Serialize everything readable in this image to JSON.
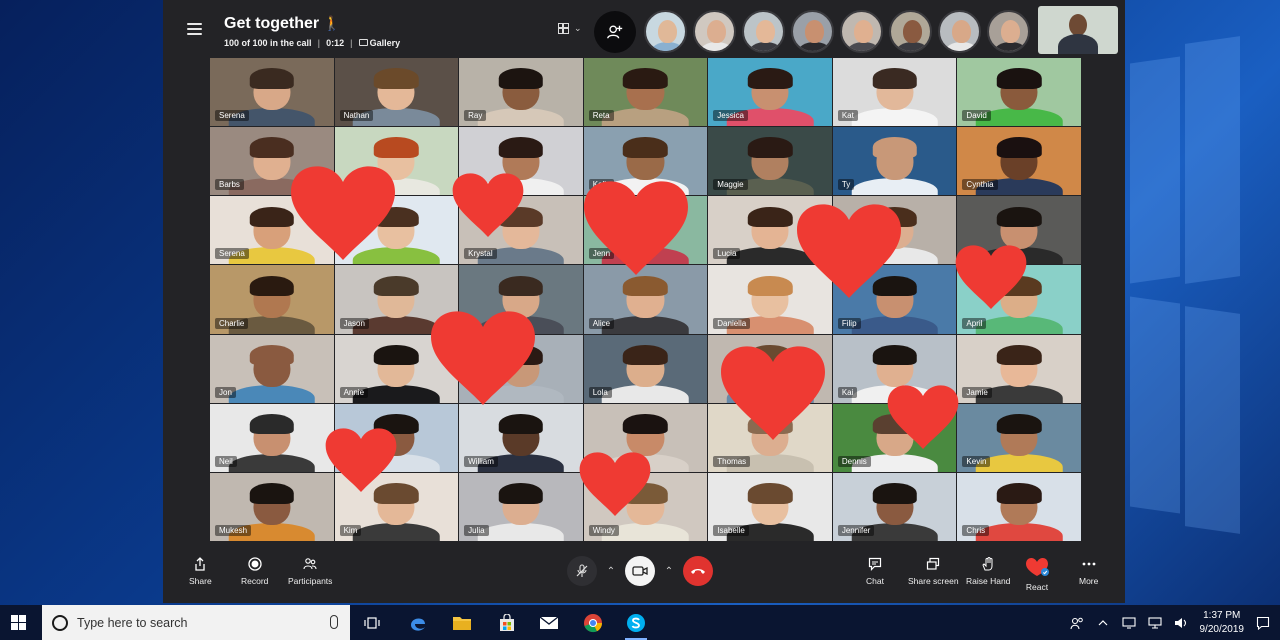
{
  "call": {
    "title": "Get together",
    "title_emoji": "🚶",
    "participants_text": "100 of 100 in the call",
    "duration": "0:12",
    "view_label": "Gallery"
  },
  "gallery": {
    "tiles": [
      {
        "name": "Serena",
        "bg": "#7a6a5a",
        "skin": "#d8a888",
        "hair": "#3a2a20",
        "shirt": "#44556a"
      },
      {
        "name": "Nathan",
        "bg": "#5b5048",
        "skin": "#e4b898",
        "hair": "#6b4a2a",
        "shirt": "#7a8a9a"
      },
      {
        "name": "Ray",
        "bg": "#b8b2a8",
        "skin": "#8a5c3e",
        "hair": "#1c1410",
        "shirt": "#d6c8b8"
      },
      {
        "name": "Reta",
        "bg": "#6f8a5a",
        "skin": "#a8704e",
        "hair": "#2a1a12",
        "shirt": "#b8a080"
      },
      {
        "name": "Jessica",
        "bg": "#4aa8c8",
        "skin": "#c89070",
        "hair": "#2a1a14",
        "shirt": "#e0506a"
      },
      {
        "name": "Kat",
        "bg": "#dcdcdc",
        "skin": "#e2b89a",
        "hair": "#3a2a22",
        "shirt": "#f4f4f4"
      },
      {
        "name": "David",
        "bg": "#a0c8a0",
        "skin": "#8a5a3c",
        "hair": "#1a1210",
        "shirt": "#48b848"
      },
      {
        "name": "Barbs",
        "bg": "#9a8a80",
        "skin": "#e0b090",
        "hair": "#4a2e20",
        "shirt": "#8a6a60"
      },
      {
        "name": "",
        "bg": "#c8d8c0",
        "skin": "#e8c0a0",
        "hair": "#b84a20",
        "shirt": "#e8e8e0"
      },
      {
        "name": "",
        "bg": "#d0d0d4",
        "skin": "#b07a58",
        "hair": "#2a1a14",
        "shirt": "#f0f0f0"
      },
      {
        "name": "Kelly",
        "bg": "#8aa0b0",
        "skin": "#9a6a48",
        "hair": "#4a2e1a",
        "shirt": "#f2f2f2"
      },
      {
        "name": "Maggie",
        "bg": "#3a4a48",
        "skin": "#b08060",
        "hair": "#2a1a14",
        "shirt": "#5a6050"
      },
      {
        "name": "Ty",
        "bg": "#2a5a8a",
        "skin": "#c89878",
        "hair": "#c89878",
        "shirt": "#e8eef4"
      },
      {
        "name": "Cynthia",
        "bg": "#d08848",
        "skin": "#6a4028",
        "hair": "#1a1010",
        "shirt": "#2a3a5a"
      },
      {
        "name": "Serena",
        "bg": "#e8e0d8",
        "skin": "#d8a07a",
        "hair": "#3a2418",
        "shirt": "#e8c840"
      },
      {
        "name": "",
        "bg": "#e0e8f0",
        "skin": "#e8c0a0",
        "hair": "#4a3020",
        "shirt": "#88c040"
      },
      {
        "name": "Krystal",
        "bg": "#c8c0b8",
        "skin": "#e4b89a",
        "hair": "#5a3a28",
        "shirt": "#6a7a8a"
      },
      {
        "name": "Jenn",
        "bg": "#8ab8a0",
        "skin": "#dcae8e",
        "hair": "#3a2a20",
        "shirt": "#c04050"
      },
      {
        "name": "Lucia",
        "bg": "#d8d0c8",
        "skin": "#e4b494",
        "hair": "#3a2418",
        "shirt": "#2a2a2a"
      },
      {
        "name": "",
        "bg": "#b8b0a8",
        "skin": "#dcae90",
        "hair": "#4a2e1c",
        "shirt": "#e8e8e8"
      },
      {
        "name": "",
        "bg": "#5a5a58",
        "skin": "#c89070",
        "hair": "#1a1410",
        "shirt": "#2a2a2a"
      },
      {
        "name": "Charlie",
        "bg": "#b89868",
        "skin": "#b07850",
        "hair": "#2a1a10",
        "shirt": "#6a5a40"
      },
      {
        "name": "Jason",
        "bg": "#c8c4c0",
        "skin": "#e0b898",
        "hair": "#4a3a2a",
        "shirt": "#5a3a30"
      },
      {
        "name": "",
        "bg": "#6a7880",
        "skin": "#d8a888",
        "hair": "#3a2a20",
        "shirt": "#4a4e58"
      },
      {
        "name": "Alice",
        "bg": "#8a9aa8",
        "skin": "#e0b090",
        "hair": "#8a5a30",
        "shirt": "#3a3a3e"
      },
      {
        "name": "Daniella",
        "bg": "#e8e4e0",
        "skin": "#e8c0a0",
        "hair": "#c88a50",
        "shirt": "#d89070"
      },
      {
        "name": "Filip",
        "bg": "#4a7aa8",
        "skin": "#c89070",
        "hair": "#1a1410",
        "shirt": "#3a5a8a"
      },
      {
        "name": "April",
        "bg": "#8ad0c8",
        "skin": "#dcae88",
        "hair": "#5a3a20",
        "shirt": "#58b878"
      },
      {
        "name": "Jon",
        "bg": "#c8c0b8",
        "skin": "#8a5a40",
        "hair": "#8a5a40",
        "shirt": "#4a88b8"
      },
      {
        "name": "Annie",
        "bg": "#d8d4d0",
        "skin": "#e2b898",
        "hair": "#1a1410",
        "shirt": "#1a1a1c"
      },
      {
        "name": "",
        "bg": "#a8b0b8",
        "skin": "#c89878",
        "hair": "#2a1a14",
        "shirt": "#b0b8c0"
      },
      {
        "name": "Lola",
        "bg": "#5a6a78",
        "skin": "#dcae8c",
        "hair": "#3a2418",
        "shirt": "#e8e8e8"
      },
      {
        "name": "",
        "bg": "#c0b8b0",
        "skin": "#e4b898",
        "hair": "#6a4a30",
        "shirt": "#6a8aa8"
      },
      {
        "name": "Kai",
        "bg": "#b8c0c8",
        "skin": "#e0b090",
        "hair": "#1a1410",
        "shirt": "#f0f0f0"
      },
      {
        "name": "Jamie",
        "bg": "#d8d0c8",
        "skin": "#e8b898",
        "hair": "#3a2418",
        "shirt": "#3a3a3a"
      },
      {
        "name": "Neil",
        "bg": "#e8e8e8",
        "skin": "#c89070",
        "hair": "#2a2a2a",
        "shirt": "#3a3a3a"
      },
      {
        "name": "",
        "bg": "#b8c8d8",
        "skin": "#8a5a40",
        "hair": "#1a1410",
        "shirt": "#d8e0e8"
      },
      {
        "name": "William",
        "bg": "#d8dce0",
        "skin": "#5a3a28",
        "hair": "#1a1410",
        "shirt": "#2a3040"
      },
      {
        "name": "",
        "bg": "#c8c0b8",
        "skin": "#c88a68",
        "hair": "#1a1210",
        "shirt": "#d8d0c8"
      },
      {
        "name": "Thomas",
        "bg": "#e0d8c8",
        "skin": "#dcae90",
        "hair": "#8a6a50",
        "shirt": "#c8c0b0"
      },
      {
        "name": "Dennis",
        "bg": "#4a8a40",
        "skin": "#d8a888",
        "hair": "#5a4030",
        "shirt": "#f0f0f0"
      },
      {
        "name": "Kevin",
        "bg": "#6a8aa0",
        "skin": "#b07a58",
        "hair": "#1a1410",
        "shirt": "#e8c840"
      },
      {
        "name": "Mukesh",
        "bg": "#c0b8b0",
        "skin": "#8a5a40",
        "hair": "#1a1410",
        "shirt": "#d88a30"
      },
      {
        "name": "Kim",
        "bg": "#e8e0d8",
        "skin": "#e4b898",
        "hair": "#6a4a30",
        "shirt": "#3a3a3a"
      },
      {
        "name": "Julia",
        "bg": "#b8b8bc",
        "skin": "#dcae90",
        "hair": "#1a1410",
        "shirt": "#e8e8e8"
      },
      {
        "name": "Windy",
        "bg": "#d0c8c0",
        "skin": "#e4b898",
        "hair": "#7a5a38",
        "shirt": "#e8e4d8"
      },
      {
        "name": "Isabelle",
        "bg": "#e8e8e8",
        "skin": "#e8c0a0",
        "hair": "#6a4a30",
        "shirt": "#2a2a2a"
      },
      {
        "name": "Jennifer",
        "bg": "#c8d0d8",
        "skin": "#8a5a40",
        "hair": "#1a1410",
        "shirt": "#3a3a3a"
      },
      {
        "name": "Chris",
        "bg": "#d8e0e8",
        "skin": "#b07a58",
        "hair": "#2a1a14",
        "shirt": "#e04840"
      }
    ]
  },
  "strip": [
    {
      "skin": "#e0b898",
      "body": "#8ab0d0",
      "bg": "#c8d8e0"
    },
    {
      "skin": "#dcae90",
      "body": "#e8e8e8",
      "bg": "#d0c8c0"
    },
    {
      "skin": "#e4b898",
      "body": "#3a3a40",
      "bg": "#bcc4c8"
    },
    {
      "skin": "#c89070",
      "body": "#2a2a2e",
      "bg": "#9aa0a8"
    },
    {
      "skin": "#e0b090",
      "body": "#4a4a50",
      "bg": "#c0b8b0"
    },
    {
      "skin": "#8a5a40",
      "body": "#3a3a40",
      "bg": "#b0a898"
    },
    {
      "skin": "#d8a888",
      "body": "#e8e8e8",
      "bg": "#b8bcc0"
    },
    {
      "skin": "#dcae90",
      "body": "#2a2a2e",
      "bg": "#a8a098"
    }
  ],
  "controls": {
    "share": "Share",
    "record": "Record",
    "participants": "Participants",
    "chat": "Chat",
    "share_screen": "Share screen",
    "raise_hand": "Raise Hand",
    "react": "React",
    "more": "More"
  },
  "taskbar": {
    "search_placeholder": "Type here to search",
    "time": "1:37 PM",
    "date": "9/20/2019"
  },
  "colors": {
    "heart": "#ef3a33",
    "hangup": "#e0332f",
    "window_bg": "#232326"
  }
}
